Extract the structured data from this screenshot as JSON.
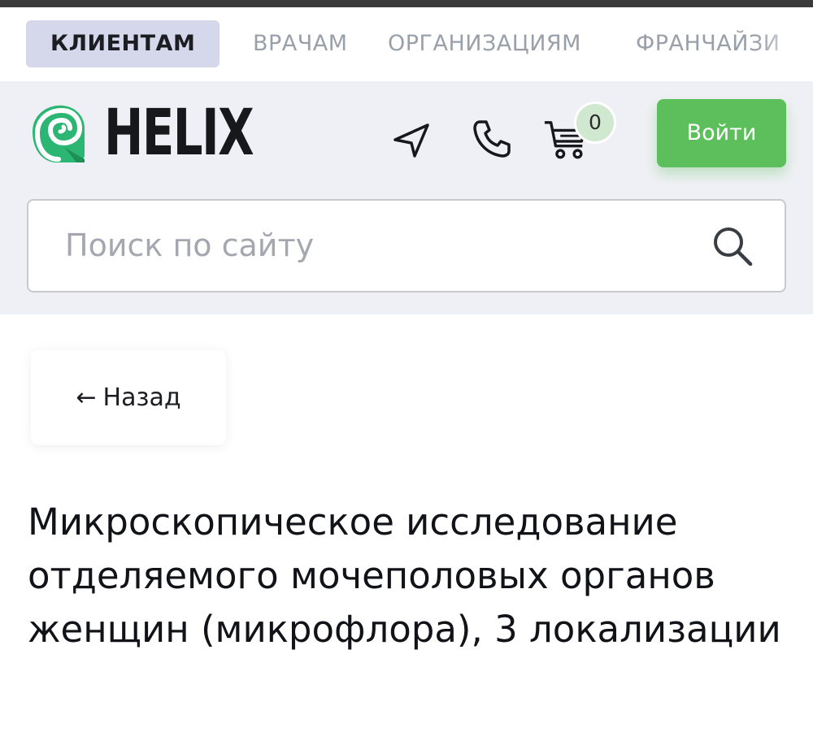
{
  "top_nav": {
    "tabs": [
      {
        "label": "КЛИЕНТАМ",
        "active": true
      },
      {
        "label": "ВРАЧАМ",
        "active": false
      },
      {
        "label": "ОРГАНИЗАЦИЯМ",
        "active": false
      },
      {
        "label": "ФРАНЧАЙЗИ",
        "active": false
      }
    ]
  },
  "header": {
    "logo_text": "HELIX",
    "icons": [
      "location-arrow-icon",
      "phone-icon",
      "cart-icon"
    ],
    "cart_count": "0",
    "login_label": "Войти"
  },
  "search": {
    "placeholder": "Поиск по сайту"
  },
  "back": {
    "label": "Назад",
    "arrow": "←"
  },
  "page": {
    "title": "Микроскопическое исследование отделяемого мочеполовых органов женщин (микрофлора), 3 локализации"
  },
  "colors": {
    "accent_green": "#5dbf5b",
    "active_tab_bg": "#d5d7ea",
    "header_bg": "#eff0f5",
    "logo_green": "#2bb673"
  }
}
